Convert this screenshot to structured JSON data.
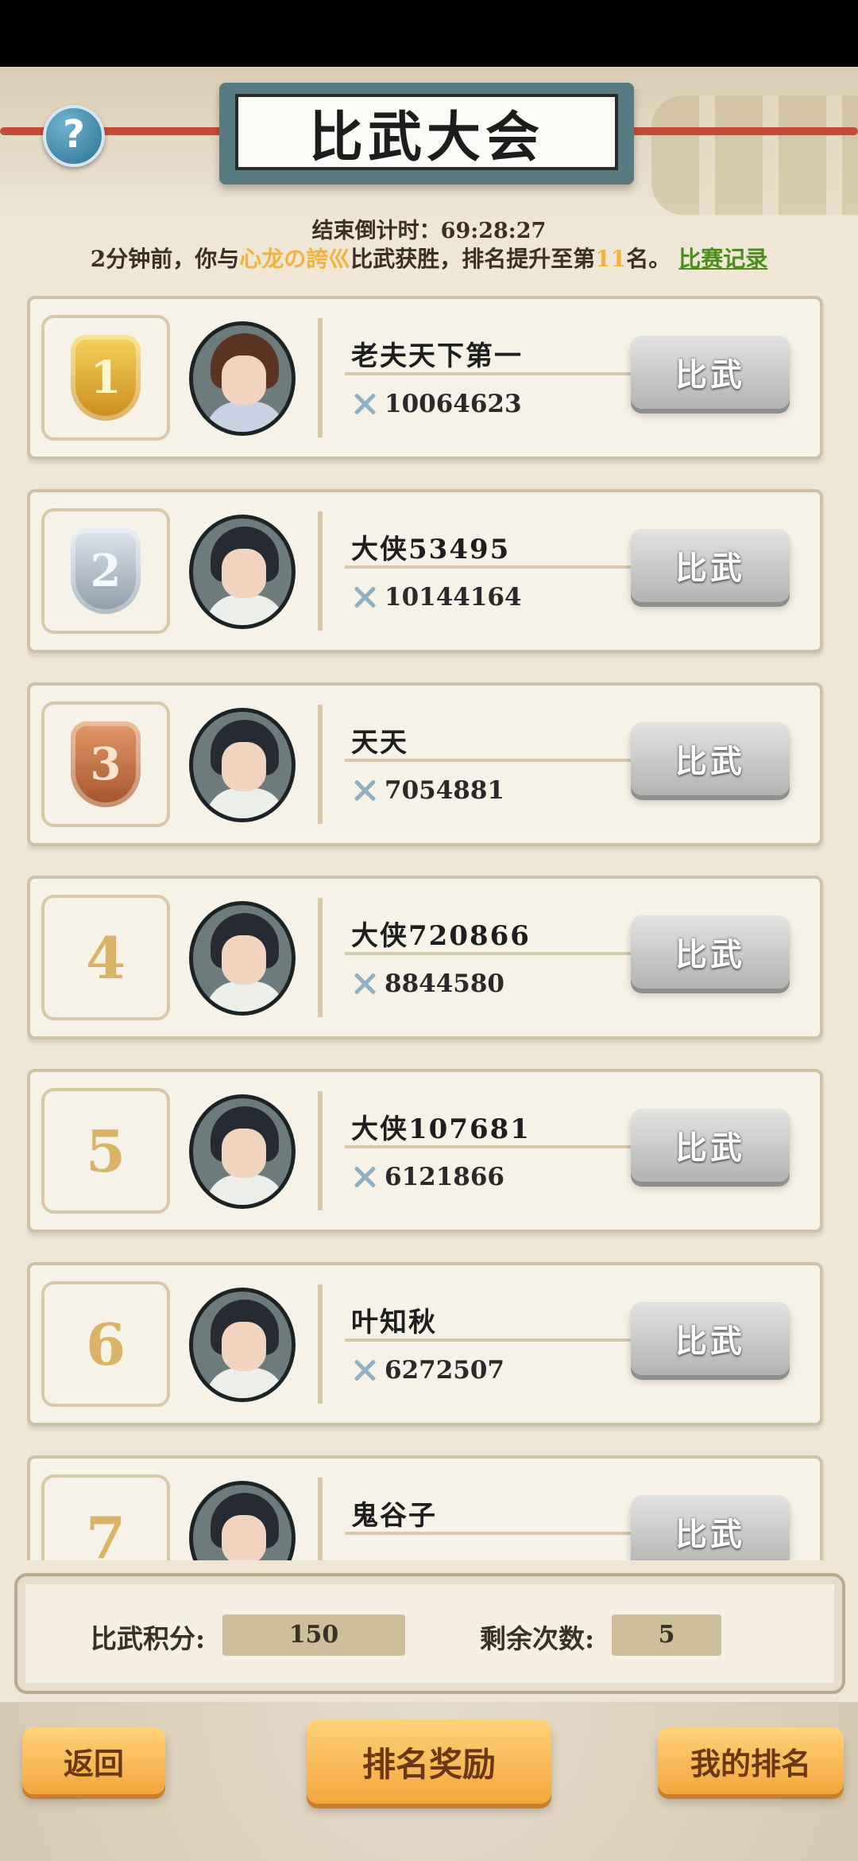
{
  "header": {
    "title": "比武大会",
    "help_icon": "?"
  },
  "countdown": {
    "label": "结束倒计时：",
    "value": "69:28:27"
  },
  "notice": {
    "prefix": "2分钟前，你与",
    "opponent": "心龙の誇巛",
    "middle": "比武获胜，排名提升至第",
    "rank": "11",
    "suffix": "名。",
    "link": "比赛记录"
  },
  "fight_label": "比武",
  "players": [
    {
      "rank": "1",
      "name": "老夫天下第一",
      "power": "10064623",
      "medal": "gold"
    },
    {
      "rank": "2",
      "name": "大侠53495",
      "power": "10144164",
      "medal": "silver"
    },
    {
      "rank": "3",
      "name": "天天",
      "power": "7054881",
      "medal": "bronze"
    },
    {
      "rank": "4",
      "name": "大侠720866",
      "power": "8844580",
      "medal": "none"
    },
    {
      "rank": "5",
      "name": "大侠107681",
      "power": "6121866",
      "medal": "none"
    },
    {
      "rank": "6",
      "name": "叶知秋",
      "power": "6272507",
      "medal": "none"
    },
    {
      "rank": "7",
      "name": "鬼谷子",
      "power": "",
      "medal": "none"
    }
  ],
  "stats": {
    "score_label": "比武积分:",
    "score_value": "150",
    "remaining_label": "剩余次数:",
    "remaining_value": "5"
  },
  "footer": {
    "back": "返回",
    "rewards": "排名奖励",
    "my_rank": "我的排名"
  },
  "colors": {
    "accent_orange": "#f3a63d",
    "highlight": "#f2b33d",
    "link_green": "#4b8f1a"
  }
}
